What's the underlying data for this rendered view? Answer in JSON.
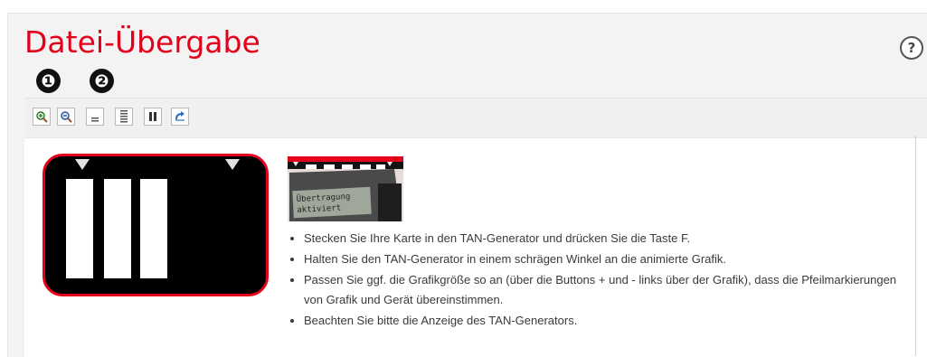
{
  "page": {
    "title": "Datei-Übergabe",
    "help_label": "?"
  },
  "markers": [
    "❶",
    "❷"
  ],
  "toolbar": {
    "buttons": [
      {
        "name": "zoom-in-icon"
      },
      {
        "name": "zoom-out-icon"
      },
      {
        "name": "slower-icon"
      },
      {
        "name": "faster-icon"
      },
      {
        "name": "pause-icon"
      },
      {
        "name": "restart-icon"
      }
    ]
  },
  "device": {
    "display_line1": "Übertragung",
    "display_line2": "aktiviert"
  },
  "instructions": [
    "Stecken Sie Ihre Karte in den TAN-Generator und drücken Sie die Taste F.",
    "Halten Sie den TAN-Generator in einem schrägen Winkel an die animierte Grafik.",
    "Passen Sie ggf. die Grafikgröße so an (über die Buttons + und - links über der Grafik), dass die Pfeilmarkierungen von Grafik und Gerät übereinstimmen.",
    "Beachten Sie bitte die Anzeige des TAN-Generators."
  ],
  "colors": {
    "brand_red": "#e3001b"
  }
}
